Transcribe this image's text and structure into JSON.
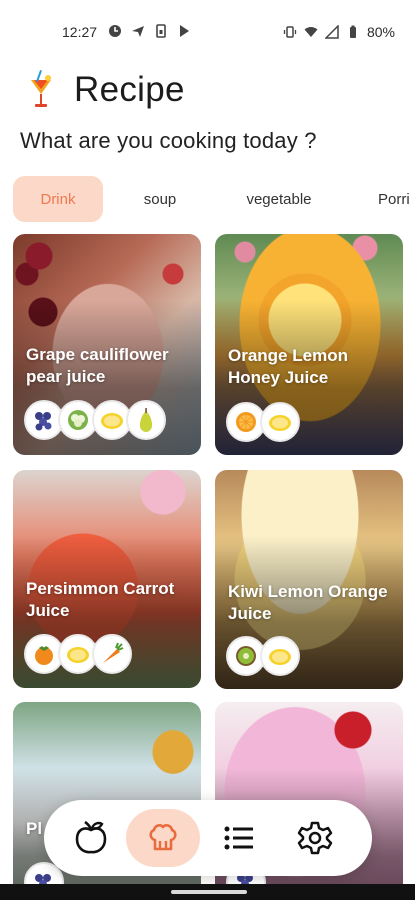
{
  "status_bar": {
    "time": "12:27",
    "battery": "80%"
  },
  "header": {
    "title": "Recipe",
    "icon": "tropical-drink-icon",
    "subtitle": "What are you cooking today ?"
  },
  "tabs": [
    {
      "label": "Drink",
      "active": true
    },
    {
      "label": "soup",
      "active": false
    },
    {
      "label": "vegetable",
      "active": false
    },
    {
      "label": "Porri",
      "active": false
    }
  ],
  "recipes": [
    {
      "title": "Grape cauliflower pear juice",
      "ingredients": [
        "grape-icon",
        "cauliflower-icon",
        "lemon-icon",
        "pear-icon"
      ]
    },
    {
      "title": "Orange Lemon Honey Juice",
      "ingredients": [
        "orange-icon",
        "lemon-icon"
      ]
    },
    {
      "title": "Persimmon Carrot Juice",
      "ingredients": [
        "persimmon-icon",
        "lemon-icon",
        "carrot-icon"
      ]
    },
    {
      "title": "Kiwi Lemon Orange Juice",
      "ingredients": [
        "kiwi-icon",
        "lemon-icon"
      ]
    },
    {
      "title": "Pl",
      "ingredients": [
        "grape-icon"
      ]
    },
    {
      "title": "",
      "ingredients": [
        "grape-icon"
      ]
    }
  ],
  "bottom_nav": [
    {
      "icon": "fruit-icon",
      "active": false
    },
    {
      "icon": "chef-hat-icon",
      "active": true
    },
    {
      "icon": "list-icon",
      "active": false
    },
    {
      "icon": "settings-icon",
      "active": false
    }
  ],
  "colors": {
    "accent": "#f07a4f",
    "accent_soft": "#fcd8c8"
  }
}
